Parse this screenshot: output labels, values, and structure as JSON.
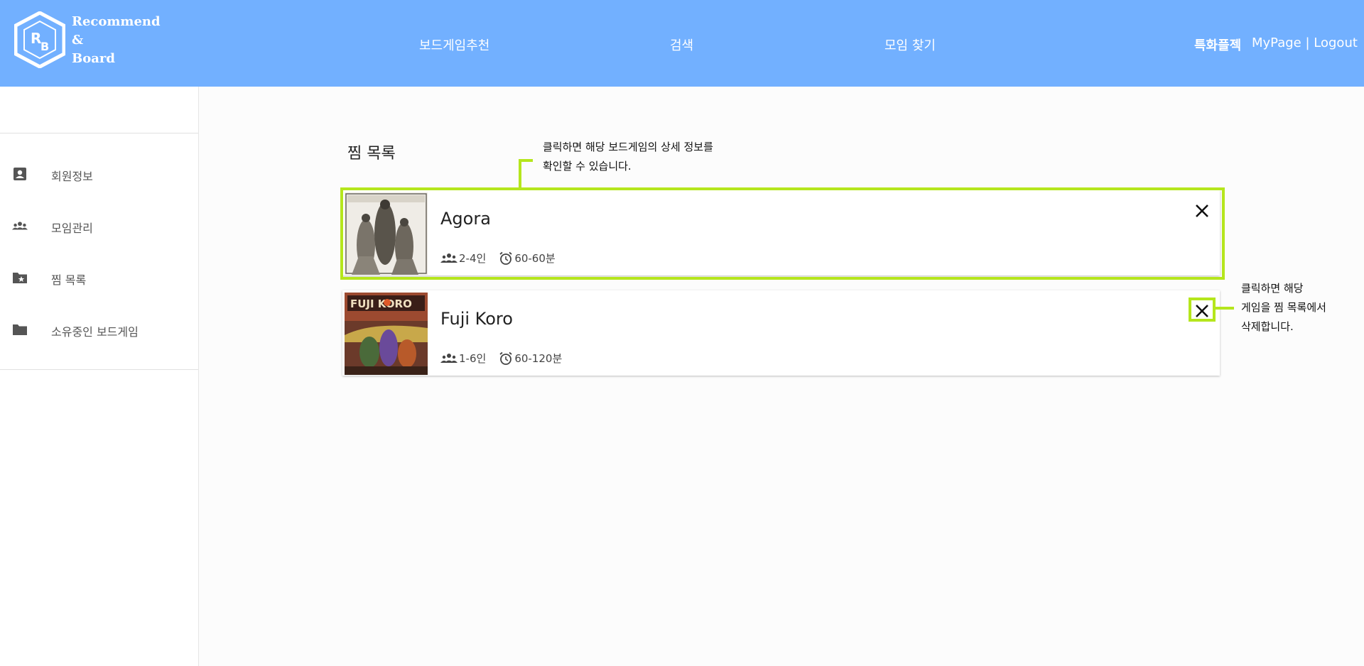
{
  "header": {
    "logo_line1": "Recommend",
    "logo_line2": "&",
    "logo_line3": "Board",
    "nav": [
      "보드게임추천",
      "검색",
      "모임 찾기"
    ],
    "special": "특화플젝",
    "mypage": "MyPage",
    "separator": " | ",
    "logout": "Logout"
  },
  "sidebar": {
    "items": [
      {
        "label": "회원정보",
        "icon": "person-card-icon"
      },
      {
        "label": "모임관리",
        "icon": "group-icon"
      },
      {
        "label": "찜 목록",
        "icon": "folder-star-icon"
      },
      {
        "label": "소유중인 보드게임",
        "icon": "folder-icon"
      }
    ]
  },
  "main": {
    "title": "찜 목록",
    "games": [
      {
        "name": "Agora",
        "players": "2-4인",
        "time": "60-60분"
      },
      {
        "name": "Fuji Koro",
        "players": "1-6인",
        "time": "60-120분"
      }
    ]
  },
  "annotations": {
    "card_note_line1": "클릭하면 해당 보드게임의 상세 정보를",
    "card_note_line2": "확인할 수 있습니다.",
    "delete_note_line1": "클릭하면 해당",
    "delete_note_line2": "게임을 찜 목록에서",
    "delete_note_line3": "삭제합니다."
  },
  "colors": {
    "header": "#72b0ff",
    "highlight": "#b5e61d"
  }
}
